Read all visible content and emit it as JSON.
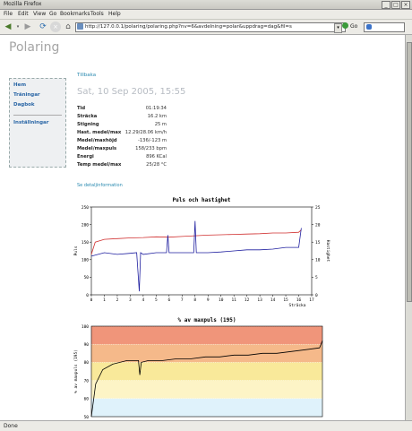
{
  "window": {
    "title": "Mozilla Firefox"
  },
  "menu": [
    "File",
    "Edit",
    "View",
    "Go",
    "Bookmarks",
    "Tools",
    "Help"
  ],
  "toolbar": {
    "url": "http://127.0.0.1/polaring/polaring.php?nv=6&avdelning=polar&uppdrag=dag&fil=s",
    "go_label": "Go"
  },
  "status": "Done",
  "page": {
    "app_title": "Polaring",
    "sidebar": {
      "items": [
        "Hem",
        "Träningar",
        "Dagbok",
        "Inställningar"
      ]
    },
    "back_link": "Tillbaka",
    "date": "Sat, 10 Sep 2005, 15:55",
    "stats": [
      {
        "label": "Tid",
        "value": "01:19:34"
      },
      {
        "label": "Sträcka",
        "value": "16.2 km"
      },
      {
        "label": "Stigning",
        "value": "25 m"
      },
      {
        "label": "Hast. medel/max",
        "value": "12.29/28.06 km/h"
      },
      {
        "label": "Medel/maxhöjd",
        "value": "-136/-123 m"
      },
      {
        "label": "Medel/maxpuls",
        "value": "158/233 bpm"
      },
      {
        "label": "Energi",
        "value": "896 KCal"
      },
      {
        "label": "Temp medel/max",
        "value": "25/28 °C"
      }
    ],
    "detail_link": "Se detaljinformation"
  },
  "chart_data": [
    {
      "type": "line",
      "title": "Puls och hastighet",
      "xlabel": "Sträcka",
      "ylabel_left": "Puls",
      "ylabel_right": "Hastighet",
      "xlim": [
        0,
        17
      ],
      "ylim_left": [
        0,
        250
      ],
      "ylim_right": [
        0,
        25
      ],
      "x_ticks": [
        "0",
        "1",
        "2",
        "3",
        "4",
        "5",
        "6",
        "7",
        "8",
        "9",
        "10",
        "11",
        "12",
        "13",
        "14",
        "15",
        "16",
        "17"
      ],
      "y_ticks_left": [
        "0",
        "50",
        "100",
        "150",
        "200",
        "250"
      ],
      "y_ticks_right": [
        "0",
        "5",
        "10",
        "15",
        "20",
        "25"
      ],
      "series": [
        {
          "color": "#d03030",
          "axis": "left",
          "x": [
            0,
            0.3,
            1,
            2,
            3,
            4,
            5,
            6,
            7,
            8,
            9,
            10,
            11,
            12,
            13,
            14,
            15,
            16,
            16.2
          ],
          "values": [
            115,
            150,
            158,
            160,
            162,
            163,
            165,
            164,
            166,
            168,
            170,
            171,
            172,
            173,
            174,
            176,
            176,
            178,
            185
          ]
        },
        {
          "color": "#2020a0",
          "axis": "right",
          "x": [
            0,
            1,
            2,
            3,
            3.5,
            3.7,
            3.8,
            4,
            5,
            5.8,
            5.9,
            6,
            7,
            7.9,
            8.0,
            8.1,
            9,
            10,
            11,
            12,
            13,
            14,
            15,
            16,
            16.2
          ],
          "values": [
            11,
            12,
            11.5,
            11.8,
            12,
            1,
            12,
            11.5,
            12,
            12,
            17,
            12,
            12,
            12,
            21,
            12,
            12,
            12.2,
            12.5,
            12.8,
            12.8,
            13,
            13.5,
            13.5,
            19
          ]
        }
      ]
    },
    {
      "type": "line",
      "title": "% av maxpuls (195)",
      "ylabel": "% av maxpuls (195)",
      "ylim": [
        50,
        100
      ],
      "y_ticks": [
        "50",
        "60",
        "70",
        "80",
        "90",
        "100"
      ],
      "zones": [
        {
          "from": 90,
          "to": 100,
          "color": "#f0957a"
        },
        {
          "from": 80,
          "to": 90,
          "color": "#f5b98a"
        },
        {
          "from": 70,
          "to": 80,
          "color": "#f9e99a"
        },
        {
          "from": 60,
          "to": 70,
          "color": "#fdf4c6"
        },
        {
          "from": 50,
          "to": 60,
          "color": "#dff2fb"
        }
      ],
      "series": [
        {
          "color": "#000000",
          "x": [
            0,
            0.3,
            0.8,
            1.5,
            2.5,
            3.3,
            3.4,
            3.5,
            4,
            5,
            6,
            7,
            8,
            9,
            10,
            11,
            12,
            13,
            14,
            15,
            16,
            16.2
          ],
          "values": [
            50,
            68,
            76,
            79,
            81,
            81,
            73,
            80,
            81,
            81,
            82,
            82,
            83,
            83,
            84,
            84,
            85,
            85,
            86,
            87,
            88,
            92
          ]
        }
      ]
    }
  ]
}
